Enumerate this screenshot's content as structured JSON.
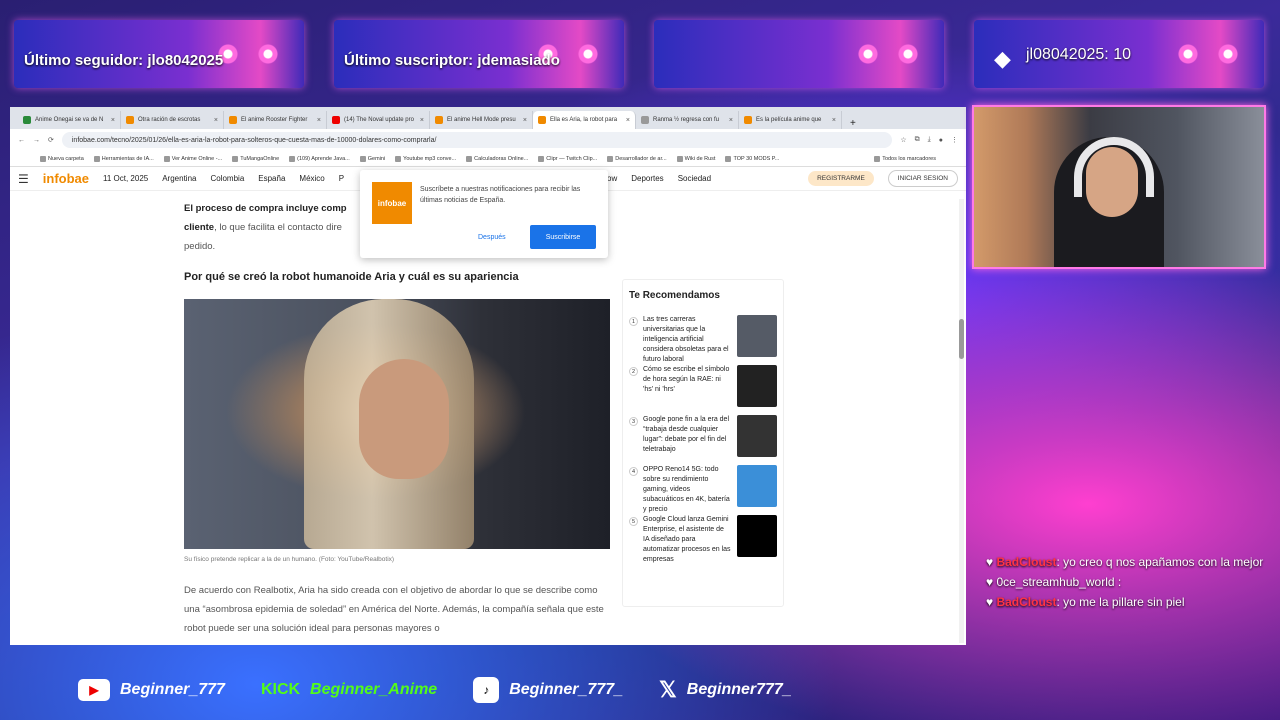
{
  "overlays": {
    "last_follower": "Último seguidor: jlo8042025",
    "last_subscriber": "Último suscriptor: jdemasiado",
    "top_donor": "jl08042025: 10"
  },
  "browser": {
    "tabs": [
      {
        "label": "Anime Onegai se va de N",
        "color": "#2a8a3a"
      },
      {
        "label": "Otra ración de escrotas",
        "color": "#f08a00"
      },
      {
        "label": "El anime Rooster Fighter",
        "color": "#f08a00"
      },
      {
        "label": "(14) The Noval update pro",
        "color": "#e00"
      },
      {
        "label": "El anime Hell Mode presu",
        "color": "#f08a00"
      },
      {
        "label": "Ella es Aria, la robot para",
        "color": "#f08a00",
        "active": true
      },
      {
        "label": "Ranma ½ regresa con fu",
        "color": "#999"
      },
      {
        "label": "Es la película anime que",
        "color": "#f08a00"
      }
    ],
    "url": "infobae.com/tecno/2025/01/26/ella-es-aria-la-robot-para-solteros-que-cuesta-mas-de-10000-dolares-como-comprarla/",
    "bookmarks": [
      "Nueva carpeta",
      "Herramientas de IA...",
      "Ver Anime Online -...",
      "TuMangaOnline",
      "(109) Aprende Java...",
      "Gemini",
      "Youtube mp3 conve...",
      "Calculadoras Online...",
      "Clipr — Twitch Clip...",
      "Desarrollador de ar...",
      "Wiki de Rust",
      "TOP 30 MODS P..."
    ],
    "all_bookmarks": "Todos los marcadores"
  },
  "site": {
    "logo": "infobae",
    "date": "11 Oct, 2025",
    "nav": [
      "Argentina",
      "Colombia",
      "España",
      "México",
      "P"
    ],
    "nav_right": [
      "Teleshow",
      "Deportes",
      "Sociedad"
    ],
    "nav_right_first": "eshow",
    "register": "REGISTRARME",
    "login": "INICIAR SESION"
  },
  "article": {
    "para1_bold": "El proceso de compra incluye comp",
    "para1_bold2": "cliente",
    "para1_rest": ", lo que facilita el contacto dire",
    "para1_end": "pedido.",
    "heading": "Por qué se creó la robot humanoide Aria y cuál es su apariencia",
    "caption": "Su físico pretende replicar a la de un humano. (Foto: YouTube/Realbotix)",
    "para2": "De acuerdo con Realbotix, Aria ha sido creada con el objetivo de abordar lo que se describe como una “asombrosa epidemia de soledad” en América del Norte. Además, la compañía señala que este robot puede ser una solución ideal para personas mayores o"
  },
  "popup": {
    "logo": "infobae",
    "text": "Suscríbete a nuestras notificaciones para recibir las últimas noticias de España.",
    "later": "Después",
    "subscribe": "Suscribirse"
  },
  "sidebar": {
    "title": "Te Recomendamos",
    "items": [
      {
        "n": "1",
        "text": "Las tres carreras universitarias que la inteligencia artificial considera obsoletas para el futuro laboral",
        "thumb": "#555b66"
      },
      {
        "n": "2",
        "text": "Cómo se escribe el símbolo de hora según la RAE: ni 'hs' ni 'hrs'",
        "thumb": "#222"
      },
      {
        "n": "3",
        "text": "Google pone fin a la era del “trabaja desde cualquier lugar”: debate por el fin del teletrabajo",
        "thumb": "#333"
      },
      {
        "n": "4",
        "text": "OPPO Reno14 5G: todo sobre su rendimiento gaming, videos subacuáticos en 4K, batería y precio",
        "thumb": "#3b8fd8"
      },
      {
        "n": "5",
        "text": "Google Cloud lanza Gemini Enterprise, el asistente de IA diseñado para automatizar procesos en las empresas",
        "thumb": "#000"
      }
    ]
  },
  "chat": [
    {
      "user": "BadCloust",
      "msg": ": yo creo q nos apañamos con la mejor",
      "style": "red"
    },
    {
      "user": "0ce_streamhub_world",
      "msg": " : ",
      "style": "plain"
    },
    {
      "user": "BadCloust",
      "msg": ": yo me la pillare sin piel",
      "style": "red"
    }
  ],
  "socials": {
    "youtube": "Beginner_777",
    "kick_label": "KICK",
    "kick": "Beginner_Anime",
    "tiktok": "Beginner_777_",
    "x": "Beginner777_"
  }
}
